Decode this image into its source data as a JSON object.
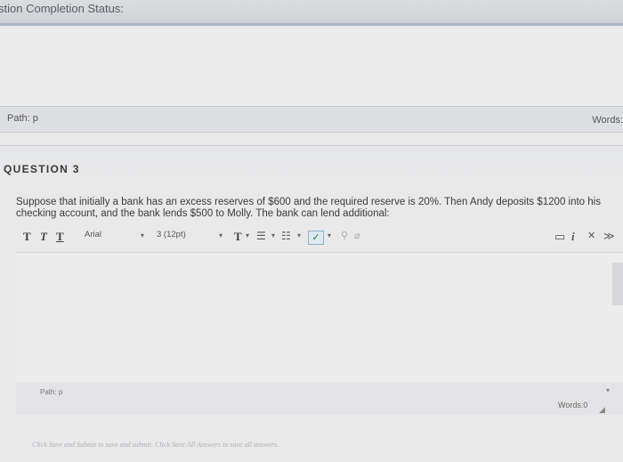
{
  "top": {
    "title": "stion Completion Status:"
  },
  "answer1": {
    "path_label": "Path: p",
    "words_label": "Words:"
  },
  "question": {
    "header": "QUESTION 3",
    "text": "Suppose that initially a bank has an excess reserves of $600 and the required reserve is 20%. Then Andy deposits $1200 into his checking account, and the bank lends $500 to Molly. The bank can lend additional:"
  },
  "toolbar": {
    "bold_label": "T",
    "italic_label": "T",
    "underline_label": "T",
    "font_family": "Arial",
    "font_size": "3 (12pt)",
    "text_color_label": "T",
    "caret": "▾",
    "list1": "☰",
    "list2": "☷",
    "spell_label": "✓",
    "link_icon": "⚲",
    "unlink_icon": "⌀",
    "preview_icon": "▭",
    "info_icon": "i",
    "expand_icon": "✕",
    "more_icon": "≫"
  },
  "answer2": {
    "path_label": "Path: p",
    "words_label": "Words:0",
    "resize_icon": "◢",
    "scroll_icon": "▾"
  },
  "bottom": {
    "note": "Click Save and Submit to save and submit. Click Save All Answers to save all answers."
  }
}
